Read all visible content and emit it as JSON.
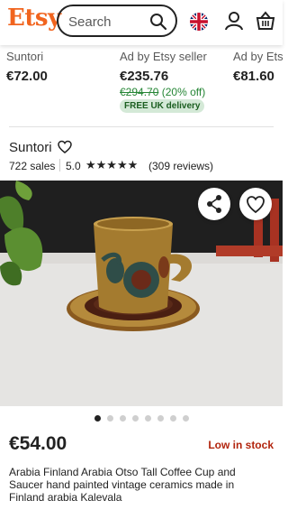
{
  "header": {
    "logo": "Etsy",
    "search_placeholder": "Search",
    "icons": [
      "search-icon",
      "uk-flag-icon",
      "user-icon",
      "basket-icon"
    ]
  },
  "related": [
    {
      "seller": "Suntori",
      "price": "€72.00"
    },
    {
      "seller": "Ad by Etsy seller",
      "price": "€235.76",
      "original_price": "€294.70",
      "discount": "(20% off)",
      "badge": "FREE UK delivery"
    },
    {
      "seller": "Ad by Ets",
      "price": "€81.60"
    }
  ],
  "shop": {
    "name": "Suntori",
    "sales": "722 sales",
    "rating": "5.0",
    "stars": "★★★★★",
    "reviews": "(309 reviews)"
  },
  "gallery": {
    "total_images": 8,
    "active_index": 0
  },
  "listing": {
    "price": "€54.00",
    "stock": "Low in stock",
    "title": "Arabia Finland Arabia Otso Tall Coffee Cup and Saucer hand painted vintage ceramics made in Finland arabia Kalevala"
  },
  "colors": {
    "brand": "#f1641e",
    "sale_green": "#258635",
    "stock_red": "#b2240d"
  }
}
